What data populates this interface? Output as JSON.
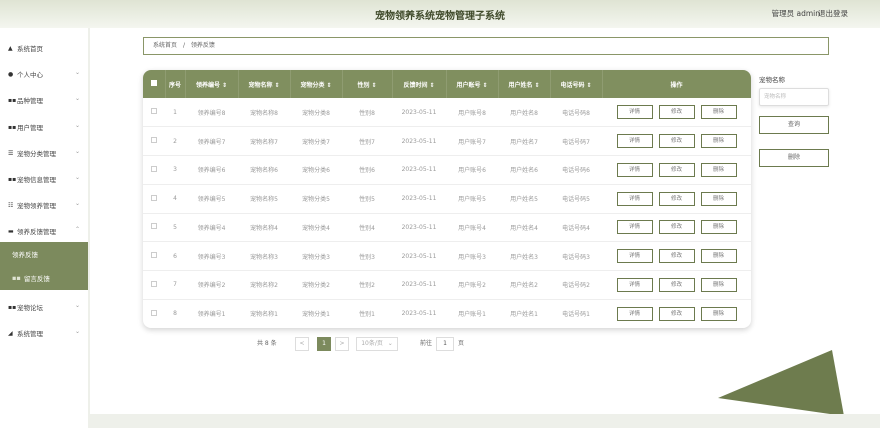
{
  "header": {
    "title": "宠物领养系统宠物管理子系统",
    "user_label": "管理员 admin",
    "logout_label": "退出登录"
  },
  "sidebar": {
    "items": [
      {
        "label": "系统首页",
        "icon": "home-icon"
      },
      {
        "label": "个人中心",
        "icon": "person-icon"
      },
      {
        "label": "品种管理",
        "icon": "grid-icon"
      },
      {
        "label": "用户管理",
        "icon": "grid-icon"
      },
      {
        "label": "宠物分类管理",
        "icon": "list-icon"
      },
      {
        "label": "宠物信息管理",
        "icon": "grid-icon"
      },
      {
        "label": "宠物领养管理",
        "icon": "list-icon"
      },
      {
        "label": "领养反馈管理",
        "icon": "folder-icon"
      },
      {
        "label": "宠物论坛",
        "icon": "grid-icon"
      },
      {
        "label": "系统管理",
        "icon": "settings-icon"
      }
    ],
    "submenu": [
      "领养反馈",
      "留言反馈"
    ]
  },
  "breadcrumb": {
    "home": "系统首页",
    "sep": "/",
    "current": "领养反馈"
  },
  "table": {
    "headers": [
      "序号",
      "领养编号 ⇕",
      "宠物名称 ⇕",
      "宠物分类 ⇕",
      "性别 ⇕",
      "反馈时间 ⇕",
      "用户账号 ⇕",
      "用户姓名 ⇕",
      "电话号码 ⇕",
      "操作"
    ],
    "rows": [
      [
        "1",
        "领养编号8",
        "宠物名称8",
        "宠物分类8",
        "性别8",
        "2023-05-11",
        "用户账号8",
        "用户姓名8",
        "电话号码8"
      ],
      [
        "2",
        "领养编号7",
        "宠物名称7",
        "宠物分类7",
        "性别7",
        "2023-05-11",
        "用户账号7",
        "用户姓名7",
        "电话号码7"
      ],
      [
        "3",
        "领养编号6",
        "宠物名称6",
        "宠物分类6",
        "性别6",
        "2023-05-11",
        "用户账号6",
        "用户姓名6",
        "电话号码6"
      ],
      [
        "4",
        "领养编号5",
        "宠物名称5",
        "宠物分类5",
        "性别5",
        "2023-05-11",
        "用户账号5",
        "用户姓名5",
        "电话号码5"
      ],
      [
        "5",
        "领养编号4",
        "宠物名称4",
        "宠物分类4",
        "性别4",
        "2023-05-11",
        "用户账号4",
        "用户姓名4",
        "电话号码4"
      ],
      [
        "6",
        "领养编号3",
        "宠物名称3",
        "宠物分类3",
        "性别3",
        "2023-05-11",
        "用户账号3",
        "用户姓名3",
        "电话号码3"
      ],
      [
        "7",
        "领养编号2",
        "宠物名称2",
        "宠物分类2",
        "性别2",
        "2023-05-11",
        "用户账号2",
        "用户姓名2",
        "电话号码2"
      ],
      [
        "8",
        "领养编号1",
        "宠物名称1",
        "宠物分类1",
        "性别1",
        "2023-05-11",
        "用户账号1",
        "用户姓名1",
        "电话号码1"
      ]
    ],
    "actions": [
      "详情",
      "修改",
      "删除"
    ]
  },
  "search": {
    "label": "宠物名称",
    "placeholder": "宠物名称",
    "query_button": "查询",
    "delete_button": "删除"
  },
  "pagination": {
    "total": "共 8 条",
    "prev": "<",
    "current_page": "1",
    "next": ">",
    "page_size": "10条/页",
    "goto_label": "前往",
    "goto_value": "1",
    "page_suffix": "页"
  },
  "colors": {
    "accent": "#7c8a5d",
    "header_bg": "#808f5f"
  }
}
